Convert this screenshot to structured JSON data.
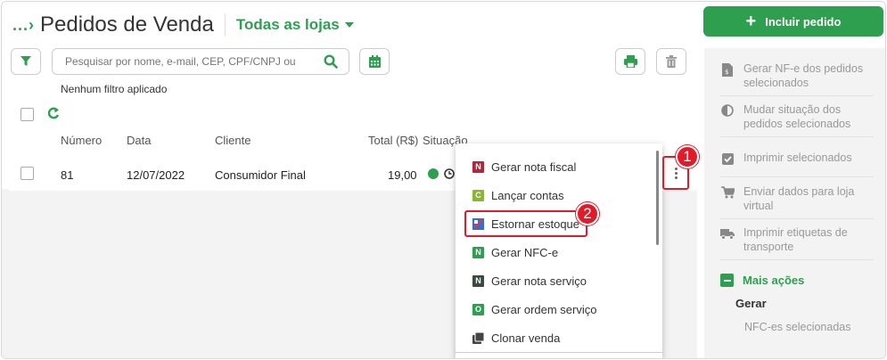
{
  "header": {
    "breadcrumb": "...",
    "title": "Pedidos de Venda",
    "store_select": "Todas as lojas",
    "include_button": "Incluir pedido"
  },
  "search": {
    "placeholder": "Pesquisar por nome, e-mail, CEP, CPF/CNPJ ou"
  },
  "filter_note": "Nenhum filtro aplicado",
  "table": {
    "columns": [
      "Número",
      "Data",
      "Cliente",
      "Total (R$)",
      "Situação"
    ],
    "rows": [
      {
        "numero": "81",
        "data": "12/07/2022",
        "cliente": "Consumidor Final",
        "total": "19,00"
      }
    ]
  },
  "context_menu": {
    "items": [
      {
        "label": "Gerar nota fiscal",
        "icon": "nota-fiscal-icon",
        "badge": "N",
        "color": "#b5253a"
      },
      {
        "label": "Lançar contas",
        "icon": "contas-icon",
        "badge": "C",
        "color": "#8bb532"
      },
      {
        "label": "Estornar estoque",
        "icon": "estoque-icon",
        "badge": "",
        "color": "#2f6fd6"
      },
      {
        "label": "Gerar NFC-e",
        "icon": "nfce-icon",
        "badge": "N",
        "color": "#2e9e4f"
      },
      {
        "label": "Gerar nota serviço",
        "icon": "nota-servico-icon",
        "badge": "N",
        "color": "#3a4a40"
      },
      {
        "label": "Gerar ordem serviço",
        "icon": "ordem-servico-icon",
        "badge": "O",
        "color": "#2e9e4f"
      },
      {
        "label": "Clonar venda",
        "icon": "clone-icon",
        "badge": "",
        "color": "#444444"
      }
    ]
  },
  "annotations": {
    "badge_1": "1",
    "badge_2": "2"
  },
  "right_panel": {
    "actions": [
      {
        "label": "Gerar NF-e dos pedidos selecionados",
        "icon": "invoice-icon"
      },
      {
        "label": "Mudar situação dos pedidos selecionados",
        "icon": "half-circle-icon"
      },
      {
        "label": "Imprimir selecionados",
        "icon": "checkbox-icon"
      },
      {
        "label": "Enviar dados para loja virtual",
        "icon": "cart-icon"
      },
      {
        "label": "Imprimir etiquetas de transporte",
        "icon": "truck-icon"
      }
    ],
    "more_actions": "Mais ações",
    "gerar": "Gerar",
    "nfce_selected": "NFC-es selecionadas"
  },
  "colors": {
    "brand_green": "#2e9e4f",
    "highlight_red": "#e21b2a",
    "muted_text": "#999999"
  }
}
